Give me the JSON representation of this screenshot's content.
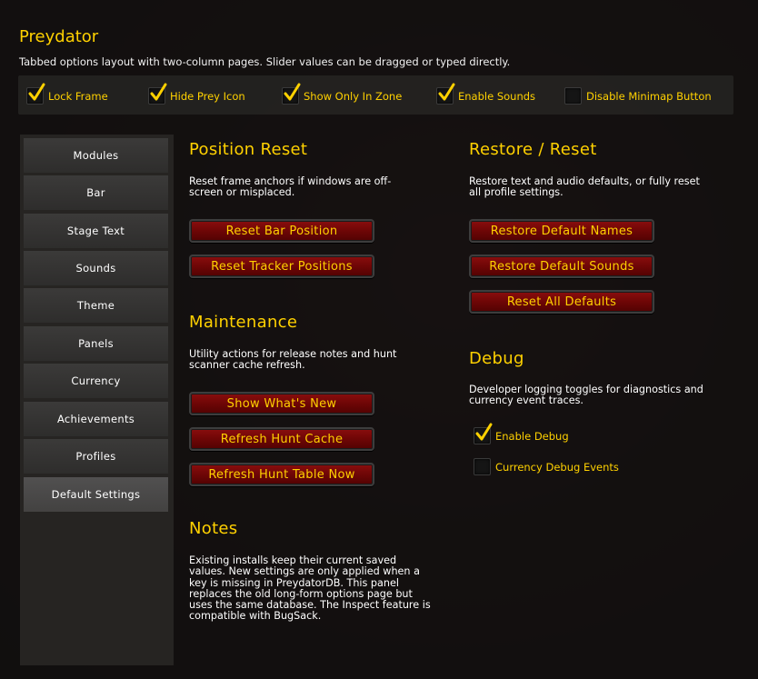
{
  "app": {
    "title": "Preydator",
    "subtitle": "Tabbed options layout with two-column pages. Slider values can be dragged or typed directly."
  },
  "topbar": [
    {
      "label": "Lock Frame",
      "checked": true
    },
    {
      "label": "Hide Prey Icon",
      "checked": true
    },
    {
      "label": "Show Only In Zone",
      "checked": true
    },
    {
      "label": "Enable Sounds",
      "checked": true
    },
    {
      "label": "Disable Minimap Button",
      "checked": false
    }
  ],
  "sidebar": {
    "items": [
      {
        "label": "Modules"
      },
      {
        "label": "Bar"
      },
      {
        "label": "Stage Text"
      },
      {
        "label": "Sounds"
      },
      {
        "label": "Theme"
      },
      {
        "label": "Panels"
      },
      {
        "label": "Currency"
      },
      {
        "label": "Achievements"
      },
      {
        "label": "Profiles"
      },
      {
        "label": "Default Settings"
      }
    ],
    "active": "Default Settings"
  },
  "position_reset": {
    "title": "Position Reset",
    "desc1": "Reset frame anchors if windows are off-",
    "desc2": "screen or misplaced.",
    "buttons": [
      "Reset Bar Position",
      "Reset Tracker Positions"
    ]
  },
  "maintenance": {
    "title": "Maintenance",
    "desc1": "Utility actions for release notes and hunt",
    "desc2": "scanner cache refresh.",
    "buttons": [
      "Show What's New",
      "Refresh Hunt Cache",
      "Refresh Hunt Table Now"
    ]
  },
  "notes": {
    "title": "Notes",
    "lines": [
      "Existing installs keep their current saved",
      "values. New settings are only applied when a",
      "key is missing in PreydatorDB. This panel",
      "replaces the old long-form options page but",
      "uses the same database. The Inspect feature is",
      "compatible with BugSack."
    ]
  },
  "restore_reset": {
    "title": "Restore / Reset",
    "desc1": "Restore text and audio defaults, or fully reset",
    "desc2": "all profile settings.",
    "buttons": [
      "Restore Default Names",
      "Restore Default Sounds",
      "Reset All Defaults"
    ]
  },
  "debug": {
    "title": "Debug",
    "desc1": "Developer logging toggles for diagnostics and",
    "desc2": "currency event traces.",
    "toggles": [
      {
        "label": "Enable Debug",
        "checked": true
      },
      {
        "label": "Currency Debug Events",
        "checked": false
      }
    ]
  },
  "colors": {
    "accent": "#ffd100",
    "button_red": "#6e0606"
  }
}
